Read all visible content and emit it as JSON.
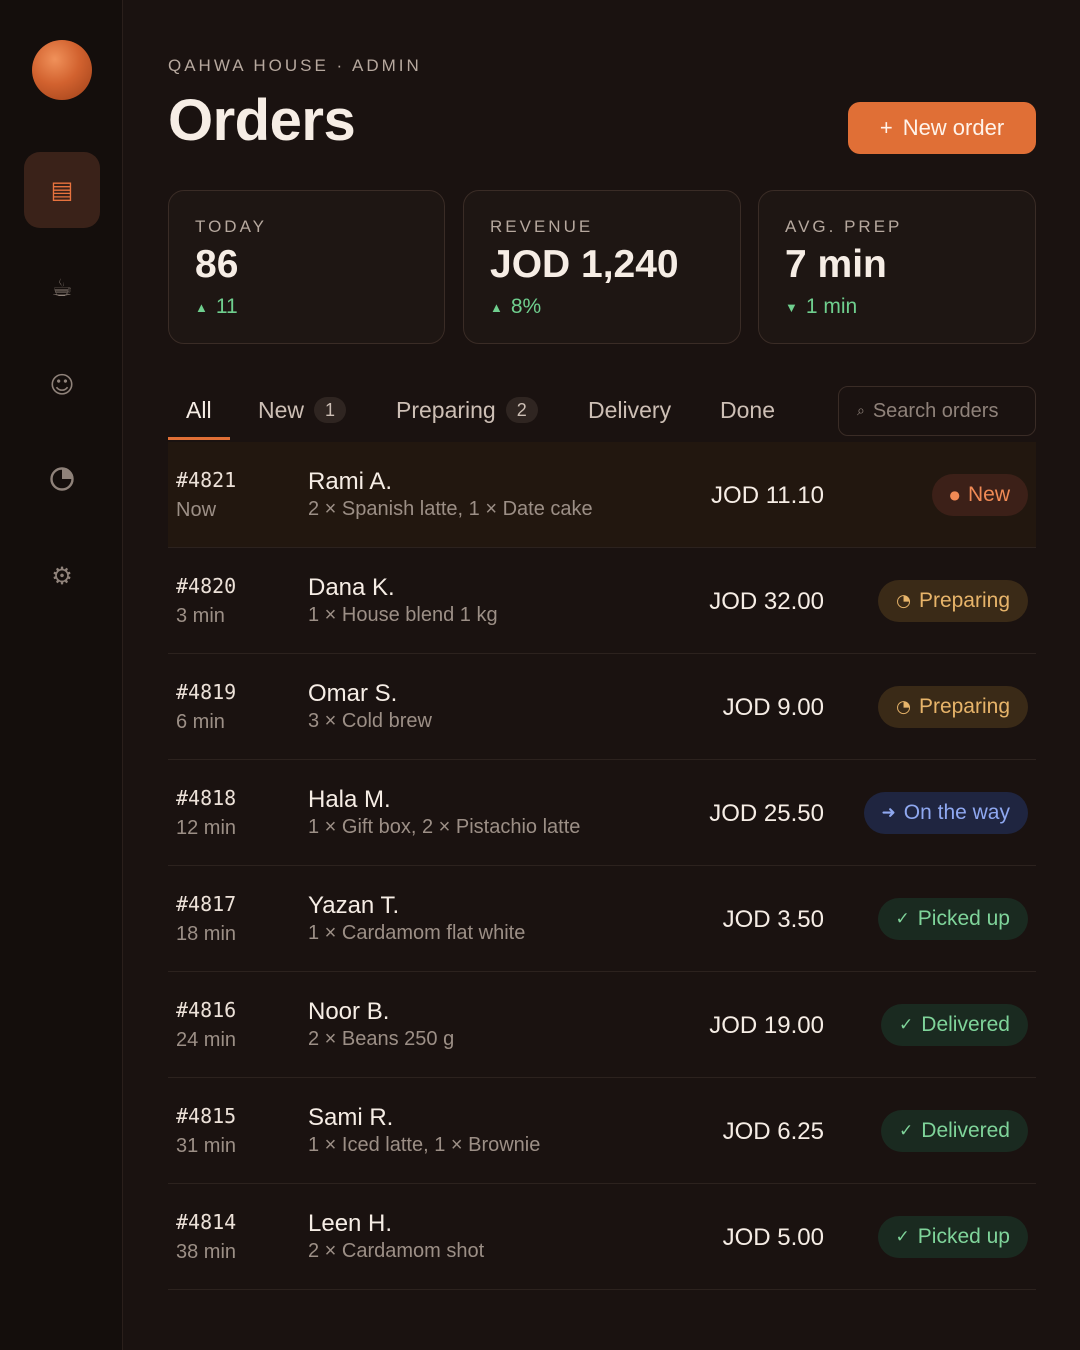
{
  "app": {
    "eyebrow": "QAHWA HOUSE · ADMIN",
    "title": "Orders"
  },
  "sidebar": {
    "items": [
      {
        "name": "orders",
        "icon": "list-icon",
        "glyph": "▤",
        "active": true
      },
      {
        "name": "menu",
        "icon": "coffee-icon",
        "glyph": "☕",
        "active": false
      },
      {
        "name": "customers",
        "icon": "smiley-icon",
        "glyph": "☺",
        "active": false
      },
      {
        "name": "reports",
        "icon": "pie-chart-icon",
        "glyph": "",
        "active": false
      },
      {
        "name": "settings",
        "icon": "gear-icon",
        "glyph": "⚙",
        "active": false
      }
    ]
  },
  "actions": {
    "new_order_plus": "+",
    "new_order_label": "New order"
  },
  "stats": [
    {
      "label": "TODAY",
      "value": "86",
      "delta": "11",
      "direction": "up"
    },
    {
      "label": "REVENUE",
      "value": "JOD 1,240",
      "delta": "8%",
      "direction": "up"
    },
    {
      "label": "AVG. PREP",
      "value": "7 min",
      "delta": "1 min",
      "direction": "down"
    }
  ],
  "tabs": [
    {
      "label": "All",
      "count": null,
      "active": true
    },
    {
      "label": "New",
      "count": "1",
      "active": false
    },
    {
      "label": "Preparing",
      "count": "2",
      "active": false
    },
    {
      "label": "Delivery",
      "count": null,
      "active": false
    },
    {
      "label": "Done",
      "count": null,
      "active": false
    }
  ],
  "search": {
    "glyph": "⌕",
    "placeholder": "Search orders",
    "value": ""
  },
  "orders": [
    {
      "id": "#4821",
      "age": "Now",
      "customer": "Rami A.",
      "items": "2 × Spanish latte, 1 × Date cake",
      "amount": "JOD 11.10",
      "status": "New",
      "status_icon": "●",
      "status_kind": "new",
      "highlight": true
    },
    {
      "id": "#4820",
      "age": "3 min",
      "customer": "Dana K.",
      "items": "1 × House blend 1 kg",
      "amount": "JOD 32.00",
      "status": "Preparing",
      "status_icon": "◔",
      "status_kind": "preparing",
      "highlight": false
    },
    {
      "id": "#4819",
      "age": "6 min",
      "customer": "Omar S.",
      "items": "3 × Cold brew",
      "amount": "JOD 9.00",
      "status": "Preparing",
      "status_icon": "◔",
      "status_kind": "preparing",
      "highlight": false
    },
    {
      "id": "#4818",
      "age": "12 min",
      "customer": "Hala M.",
      "items": "1 × Gift box, 2 × Pistachio latte",
      "amount": "JOD 25.50",
      "status": "On the way",
      "status_icon": "➜",
      "status_kind": "on-the-way",
      "highlight": false
    },
    {
      "id": "#4817",
      "age": "18 min",
      "customer": "Yazan T.",
      "items": "1 × Cardamom flat white",
      "amount": "JOD 3.50",
      "status": "Picked up",
      "status_icon": "✓",
      "status_kind": "picked-up",
      "highlight": false
    },
    {
      "id": "#4816",
      "age": "24 min",
      "customer": "Noor B.",
      "items": "2 × Beans 250 g",
      "amount": "JOD 19.00",
      "status": "Delivered",
      "status_icon": "✓",
      "status_kind": "delivered",
      "highlight": false
    },
    {
      "id": "#4815",
      "age": "31 min",
      "customer": "Sami R.",
      "items": "1 × Iced latte, 1 × Brownie",
      "amount": "JOD 6.25",
      "status": "Delivered",
      "status_icon": "✓",
      "status_kind": "delivered",
      "highlight": false
    },
    {
      "id": "#4814",
      "age": "38 min",
      "customer": "Leen H.",
      "items": "2 × Cardamom shot",
      "amount": "JOD 5.00",
      "status": "Picked up",
      "status_icon": "✓",
      "status_kind": "picked-up",
      "highlight": false
    }
  ],
  "colors": {
    "background": "#1a1210",
    "accent": "#e06f36",
    "positive": "#6fcf8e"
  }
}
